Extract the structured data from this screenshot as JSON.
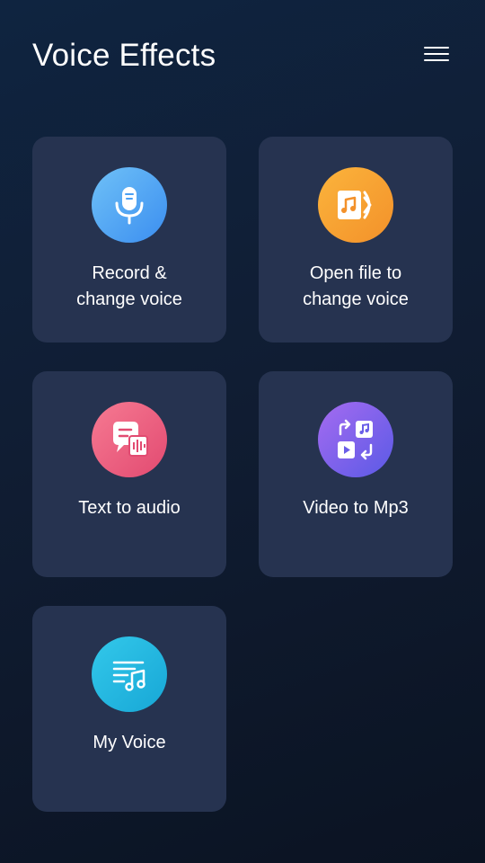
{
  "header": {
    "title": "Voice Effects",
    "menu_icon": "hamburger-menu-icon"
  },
  "cards": [
    {
      "id": "record",
      "label": "Record &\nchange voice",
      "icon": "microphone-icon",
      "color": "#4a9ff3"
    },
    {
      "id": "open",
      "label": "Open file to\nchange voice",
      "icon": "music-file-icon",
      "color": "#f6a232"
    },
    {
      "id": "text",
      "label": "Text to audio",
      "icon": "speech-bubble-audio-icon",
      "color": "#eb5f80"
    },
    {
      "id": "video",
      "label": "Video to Mp3",
      "icon": "video-to-audio-convert-icon",
      "color": "#7d62ec"
    },
    {
      "id": "myvoice",
      "label": "My Voice",
      "icon": "playlist-music-icon",
      "color": "#22b6df"
    }
  ],
  "colors": {
    "background": "#0f1c30",
    "card": "#263350",
    "text": "#ffffff"
  }
}
